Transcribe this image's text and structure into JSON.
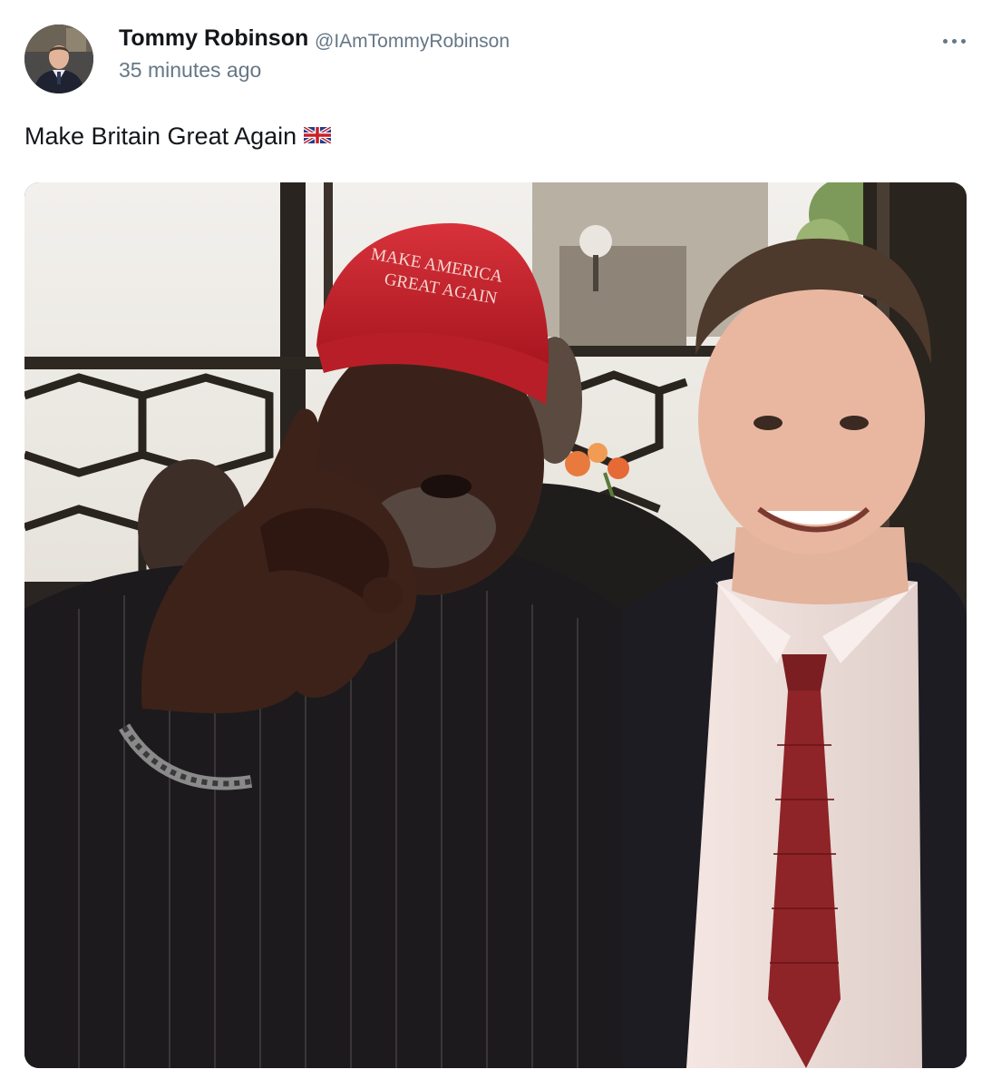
{
  "author": {
    "display_name": "Tommy Robinson",
    "handle": "@IAmTommyRobinson",
    "avatar_icon": "profile-photo"
  },
  "timestamp": "35 minutes ago",
  "more_icon": "more-options-icon",
  "tweet": {
    "text": "Make Britain Great Again",
    "emoji": "uk-flag-icon"
  },
  "media": {
    "cap_line_1": "MAKE AMERICA",
    "cap_line_2": "GREAT AGAIN"
  },
  "colors": {
    "text_primary": "#14171a",
    "text_secondary": "#657786",
    "cap_red": "#c8202b"
  }
}
